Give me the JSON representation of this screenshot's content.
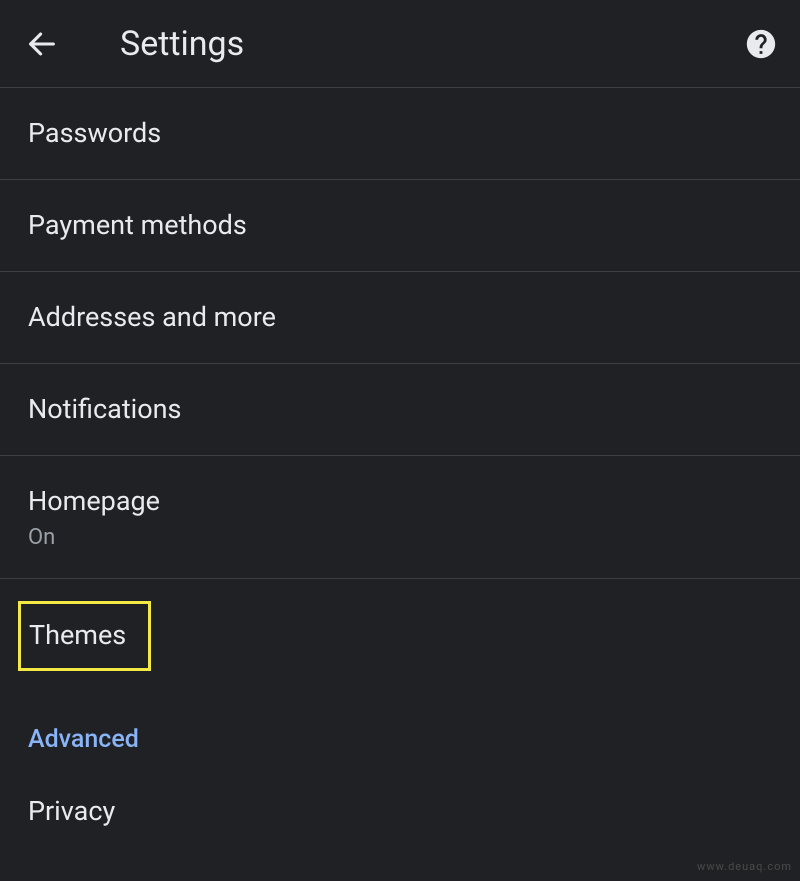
{
  "header": {
    "title": "Settings"
  },
  "items": {
    "passwords": {
      "label": "Passwords"
    },
    "payment": {
      "label": "Payment methods"
    },
    "addresses": {
      "label": "Addresses and more"
    },
    "notifications": {
      "label": "Notifications"
    },
    "homepage": {
      "label": "Homepage",
      "status": "On"
    },
    "themes": {
      "label": "Themes"
    },
    "privacy": {
      "label": "Privacy"
    }
  },
  "section": {
    "advanced": "Advanced"
  },
  "watermark": "www.deuaq.com"
}
